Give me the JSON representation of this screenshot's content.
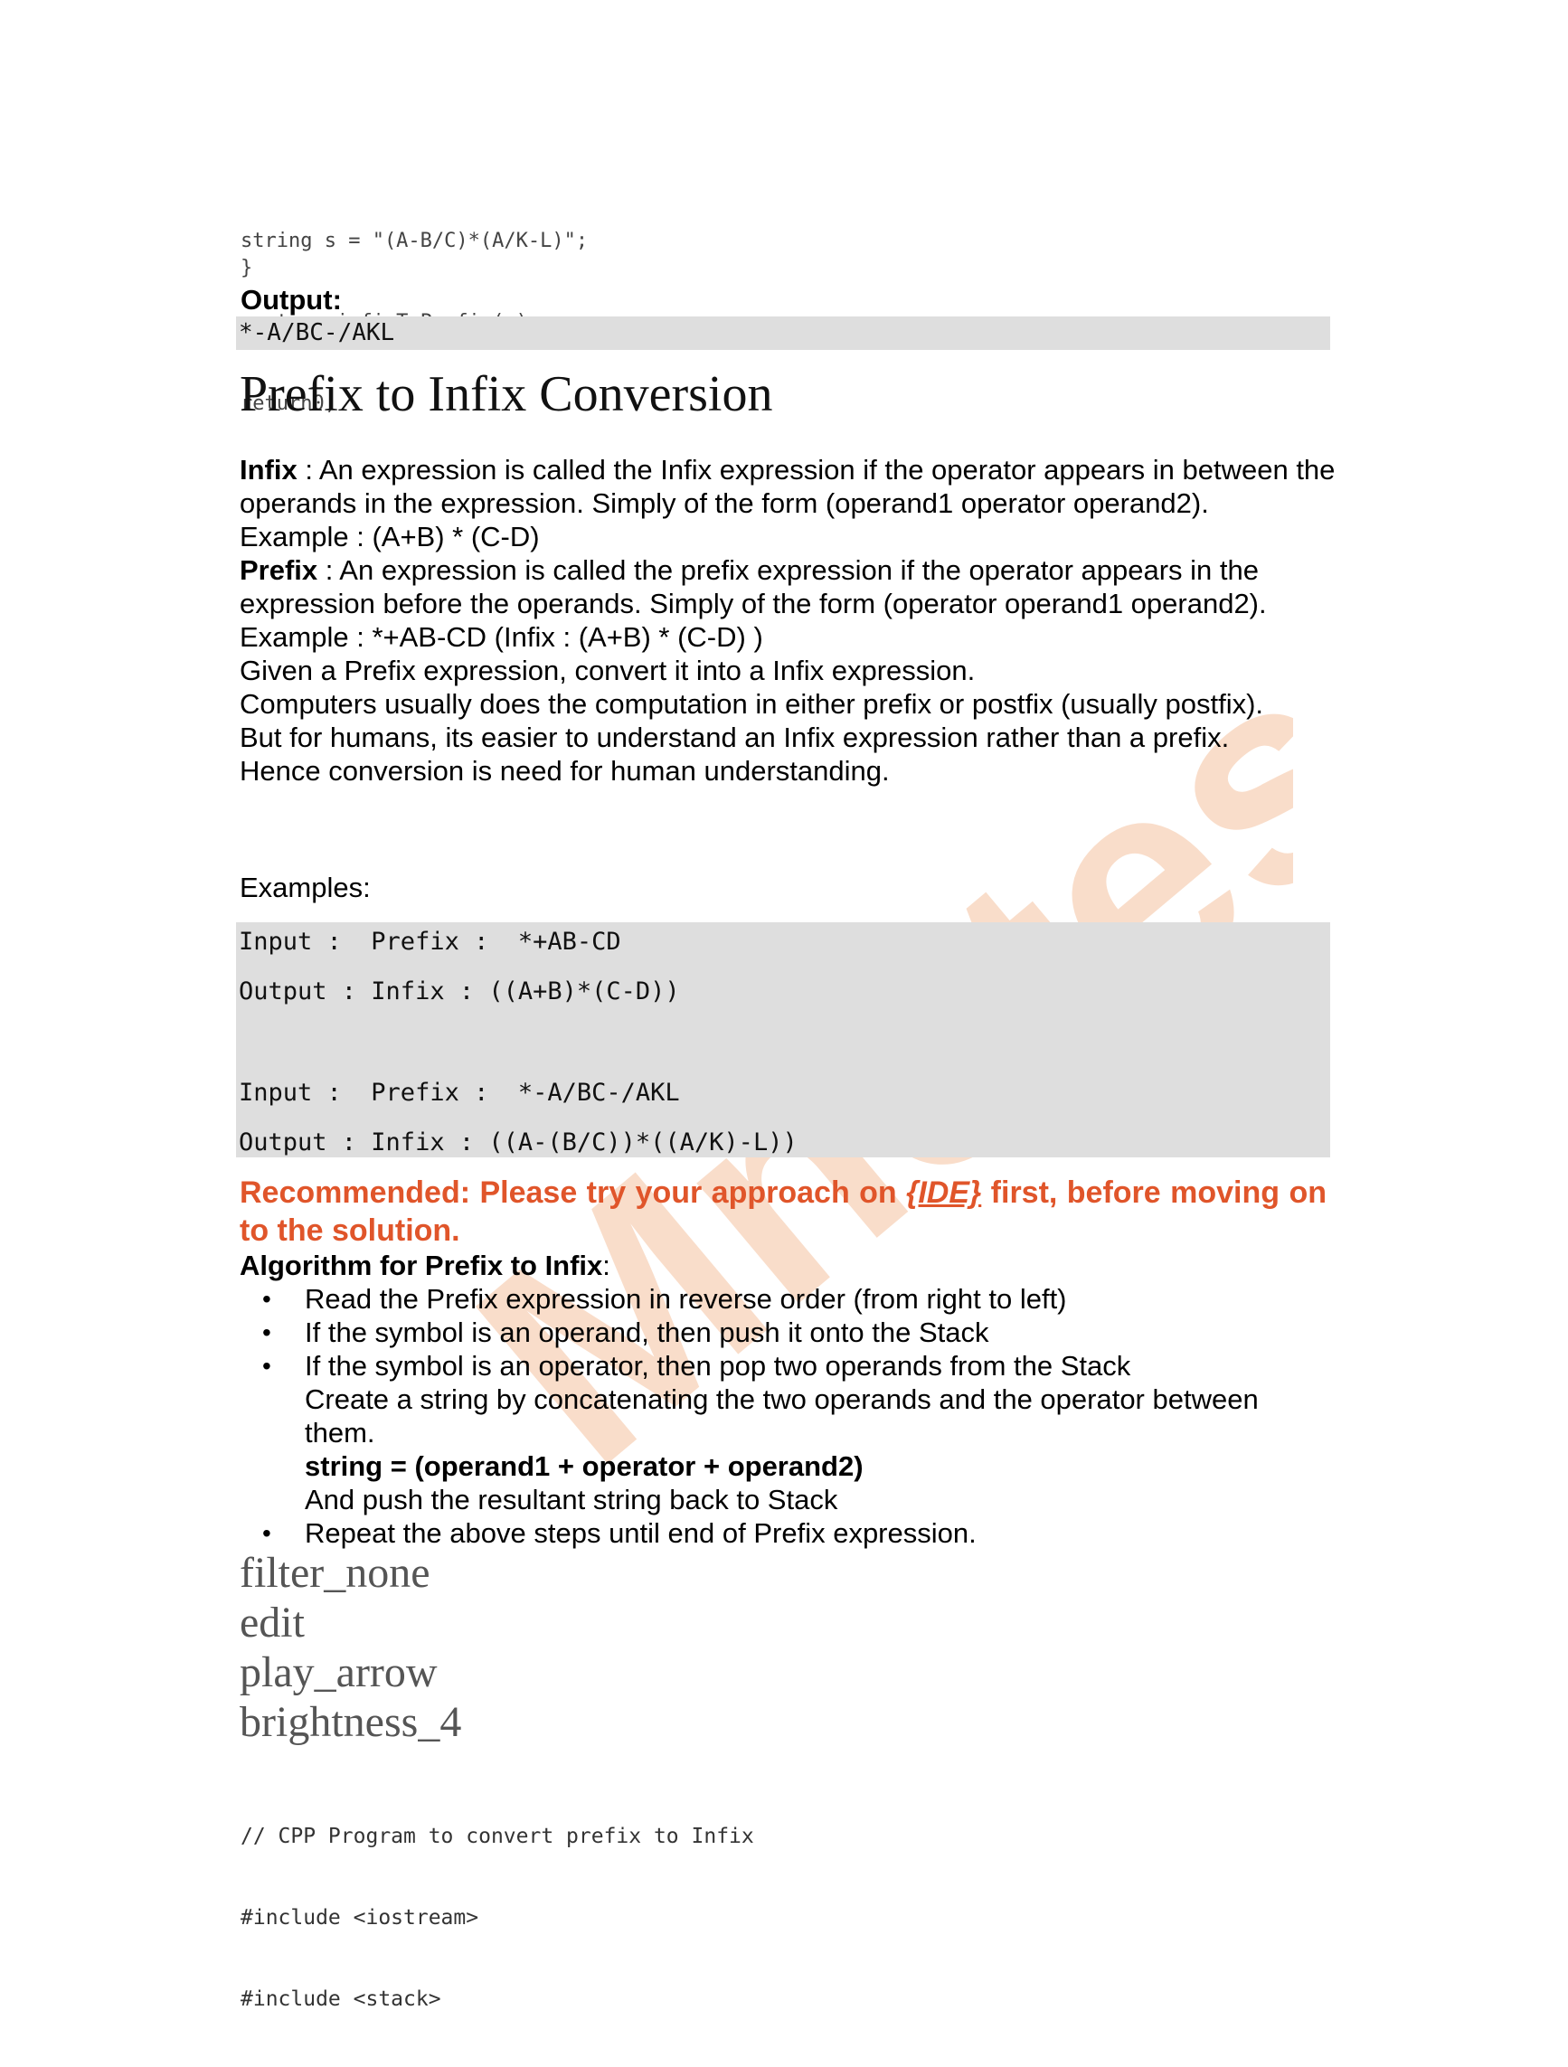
{
  "code_top": {
    "lines": [
      "string s = \"(A-B/C)*(A/K-L)\";",
      "cout << infixToPrefix(s);",
      "return0;"
    ],
    "closing_brace": "}"
  },
  "output": {
    "label": "Output:",
    "value": "*-A/BC-/AKL"
  },
  "heading": "Prefix to Infix Conversion",
  "prose": {
    "infix_term": "Infix",
    "infix_def": " : An expression is called the Infix expression if the operator appears in between the operands in the expression. Simply of the form (operand1 operator operand2).",
    "infix_example": "Example : (A+B) * (C-D)",
    "prefix_term": "Prefix",
    "prefix_def": " : An expression is called the prefix expression if the operator appears in the expression before the operands. Simply of the form (operator operand1 operand2).",
    "prefix_example": "Example : *+AB-CD (Infix : (A+B) * (C-D) )",
    "task": "Given a Prefix expression, convert it into a Infix expression.",
    "line_computers": "Computers usually does the computation in either prefix or postfix (usually postfix).",
    "line_humans": "But for humans, its easier to understand an Infix expression rather than a prefix.",
    "line_hence": "Hence conversion is need for human understanding."
  },
  "examples": {
    "label": "Examples:",
    "lines": [
      "Input :  Prefix :  *+AB-CD",
      "Output : Infix : ((A+B)*(C-D))",
      "Input :  Prefix :  *-A/BC-/AKL",
      "Output : Infix : ((A-(B/C))*((A/K)-L))"
    ]
  },
  "recommend": {
    "before": "Recommended: Please try your approach on ",
    "ide": "{IDE}",
    "after": " first, before moving on to the solution."
  },
  "algorithm": {
    "title_bold": "Algorithm for Prefix to Infix",
    "title_colon": ":",
    "items": [
      "Read the Prefix expression in reverse order (from right to left)",
      "If the symbol is an operand, then push it onto the Stack",
      "If the symbol is an operator, then pop two operands from the Stack",
      "Repeat the above steps until end of Prefix expression."
    ],
    "sub_line_1": "Create a string by concatenating the two operands and the operator between them.",
    "sub_bold": "string = (operand1 + operator + operand2)",
    "sub_line_2": "And push the resultant string back to Stack",
    "bullet": "•"
  },
  "icon_words": [
    "filter_none",
    "edit",
    "play_arrow",
    "brightness_4"
  ],
  "code_bottom": {
    "lines": [
      "// CPP Program to convert prefix to Infix",
      "#include <iostream>",
      "#include <stack>"
    ]
  },
  "watermark": {
    "text": "Mnotes",
    "color": "#f2b48a"
  }
}
